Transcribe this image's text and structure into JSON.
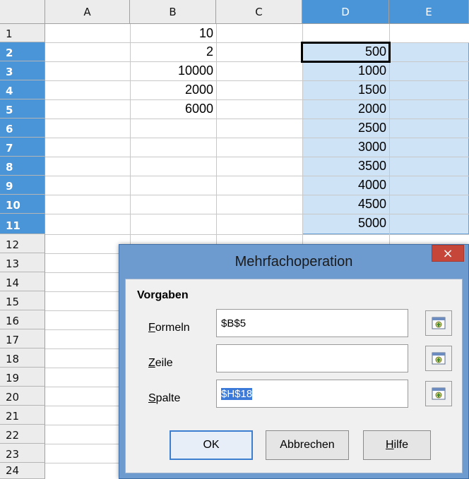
{
  "columns": [
    "A",
    "B",
    "C",
    "D",
    "E"
  ],
  "rows": [
    "1",
    "2",
    "3",
    "4",
    "5",
    "6",
    "7",
    "8",
    "9",
    "10",
    "11",
    "12",
    "13",
    "14",
    "15",
    "16",
    "17",
    "18",
    "19",
    "20",
    "21",
    "22",
    "23",
    "24"
  ],
  "cells": {
    "B1": "10",
    "B2": "2",
    "B3": "10000",
    "B4": "2000",
    "B5": "6000",
    "D2": "500",
    "D3": "1000",
    "D4": "1500",
    "D5": "2000",
    "D6": "2500",
    "D7": "3000",
    "D8": "3500",
    "D9": "4000",
    "D10": "4500",
    "D11": "5000"
  },
  "dialog": {
    "title": "Mehrfachoperation",
    "close_glyph": "×",
    "section": "Vorgaben",
    "formeln": {
      "accel": "F",
      "rest": "ormeln",
      "value": "$B$5"
    },
    "zeile": {
      "accel": "Z",
      "rest": "eile",
      "value": ""
    },
    "spalte": {
      "accel": "S",
      "rest": "palte",
      "value": "$H$18"
    },
    "ok_label": "OK",
    "cancel_label": "Abbrechen",
    "help": {
      "accel": "H",
      "rest": "ilfe"
    }
  },
  "colors": {
    "selection_header": "#4a94d8",
    "selection_fill": "#cfe3f7",
    "dialog_frame": "#6d9bd0",
    "close_button": "#c7463a"
  }
}
